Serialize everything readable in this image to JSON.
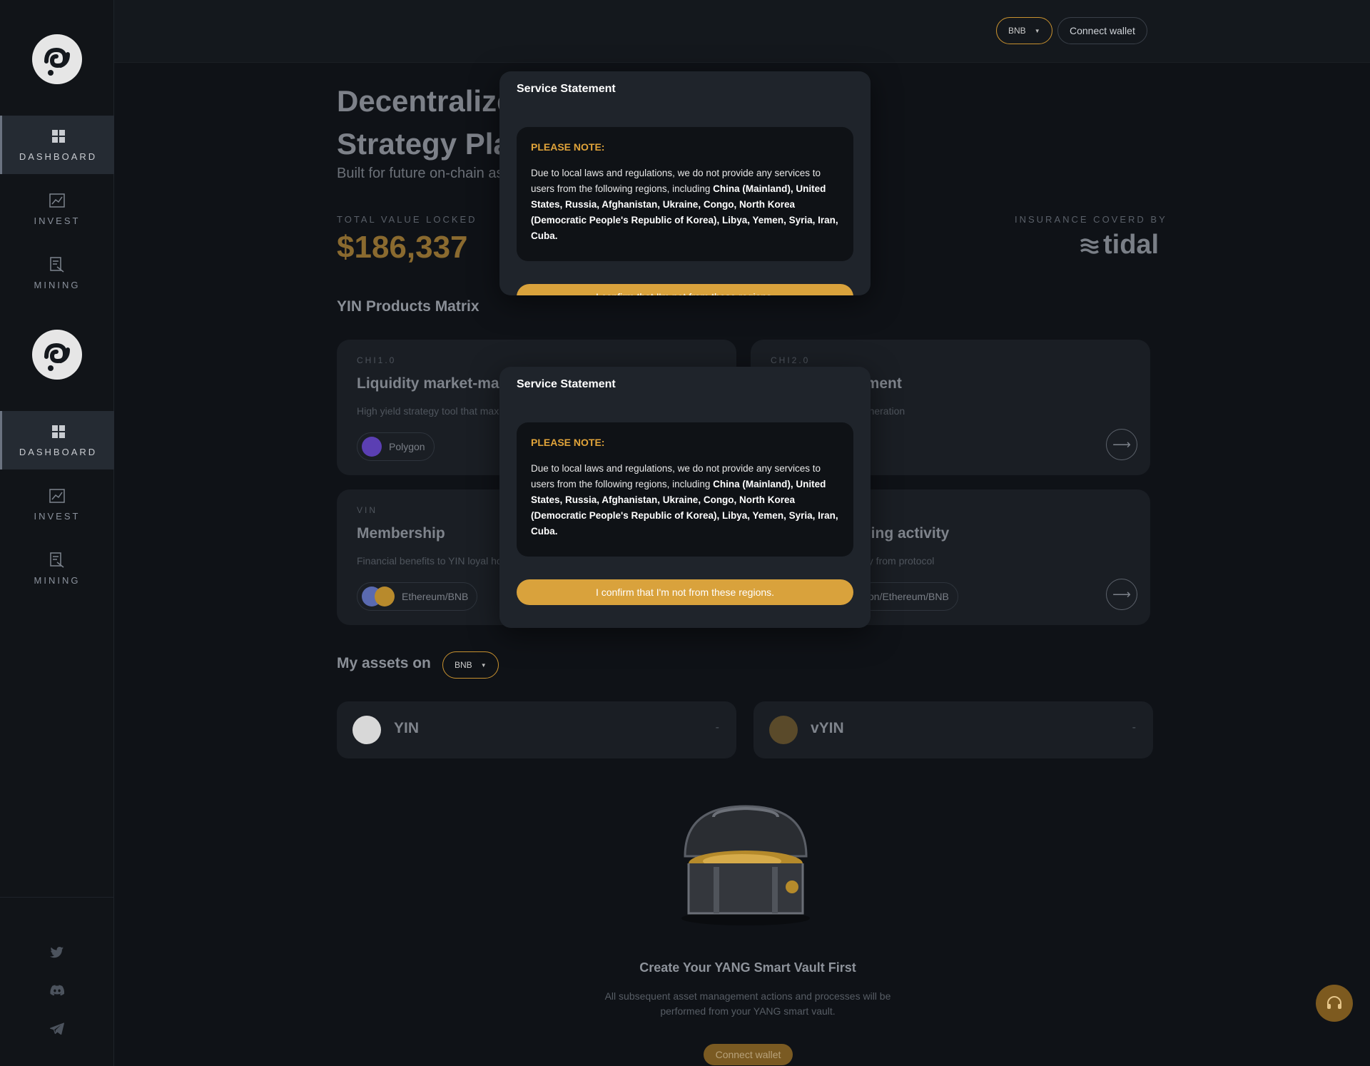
{
  "sidebar": {
    "items": [
      {
        "label": "DASHBOARD",
        "icon": "dashboard-icon"
      },
      {
        "label": "INVEST",
        "icon": "chart-icon"
      },
      {
        "label": "MINING",
        "icon": "mining-icon"
      }
    ],
    "social": [
      "twitter-icon",
      "discord-icon",
      "telegram-icon"
    ]
  },
  "topbar": {
    "network": "BNB",
    "connect": "Connect wallet"
  },
  "hero": {
    "title_line1": "Decentralize",
    "title_line2": "Strategy Pla",
    "subtitle": "Built for future on-chain as"
  },
  "stats": {
    "tvl_label": "TOTAL VALUE LOCKED",
    "tvl_value": "$186,337",
    "insurance_label": "INSURANCE COVERD BY",
    "insurance_name": "tidal"
  },
  "products": {
    "title": "YIN Products Matrix",
    "cards": [
      {
        "tag": "CHI1.0",
        "title": "Liquidity market-mak",
        "desc": "High yield strategy tool that max",
        "network": "Polygon"
      },
      {
        "tag": "CHI2.0",
        "title": "ement",
        "desc": "generation",
        "network": ""
      },
      {
        "tag": "VIN",
        "title": "Membership",
        "desc": "Financial benefits to YIN loyal ho",
        "network": "Ethereum/BNB"
      },
      {
        "tag": "",
        "title": "ining activity",
        "desc": "nity from protocol",
        "network": "on/Ethereum/BNB"
      }
    ]
  },
  "assets": {
    "title": "My assets on",
    "network": "BNB",
    "items": [
      {
        "name": "YIN",
        "value": "-"
      },
      {
        "name": "vYIN",
        "value": "-"
      }
    ]
  },
  "empty_state": {
    "title": "Create Your YANG Smart Vault First",
    "desc": "All subsequent asset management actions and processes will be performed from your YANG smart vault.",
    "button": "Connect wallet"
  },
  "modal": {
    "title": "Service Statement",
    "note_head": "PLEASE NOTE:",
    "note_intro": "Due to local laws and regulations, we do not provide any services to users from the following regions, including ",
    "note_regions": "China (Mainland), United States, Russia, Afghanistan, Ukraine, Congo, North Korea (Democratic People's Republic of Korea), Libya, Yemen, Syria, Iran, Cuba.",
    "confirm": "I confirm that I'm not from these regions."
  },
  "colors": {
    "accent": "#d9a23c",
    "background": "#0f1217",
    "card": "#1a1e24"
  }
}
